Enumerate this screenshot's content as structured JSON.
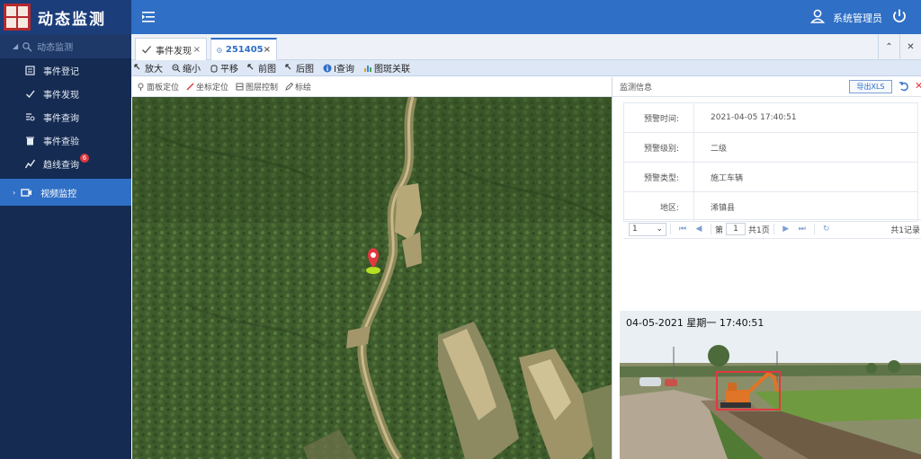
{
  "header": {
    "app_title": "动态监测",
    "user_name": "系统管理员"
  },
  "sidebar": {
    "group_label": "动态监测",
    "items": [
      {
        "label": "事件登记",
        "icon": "edit-icon"
      },
      {
        "label": "事件发现",
        "icon": "check-icon"
      },
      {
        "label": "事件查询",
        "icon": "search-list-icon"
      },
      {
        "label": "事件查验",
        "icon": "trash-icon"
      },
      {
        "label": "趋线查询",
        "icon": "trend-icon",
        "badge": "6"
      }
    ],
    "active_item": {
      "label": "视频监控",
      "icon": "video-icon"
    }
  },
  "tabs": [
    {
      "label": "事件发现",
      "active": false
    },
    {
      "label": "251405",
      "active": true
    }
  ],
  "map_toolbar": [
    "放大",
    "缩小",
    "平移",
    "前图",
    "后图",
    "I查询",
    "图斑关联"
  ],
  "sub_toolbar": [
    "面板定位",
    "坐标定位",
    "图层控制",
    "标绘"
  ],
  "right_panel": {
    "title": "监测信息",
    "export_label": "导出XLS",
    "rows": [
      {
        "label": "预警时间:",
        "value": "2021-04-05 17:40:51"
      },
      {
        "label": "预警级别:",
        "value": "二级"
      },
      {
        "label": "预警类型:",
        "value": "施工车辆"
      },
      {
        "label": "地区:",
        "value": "浠镇县"
      }
    ],
    "pager": {
      "page_size": "1",
      "page_prefix": "第",
      "page_current": "1",
      "page_suffix": "共1页",
      "total": "共1记录"
    }
  },
  "video": {
    "timestamp": "04-05-2021  星期一  17:40:51"
  },
  "colors": {
    "header_blue": "#2f6fc6",
    "sidebar_navy": "#152b52",
    "alert_red": "#e2383f"
  }
}
